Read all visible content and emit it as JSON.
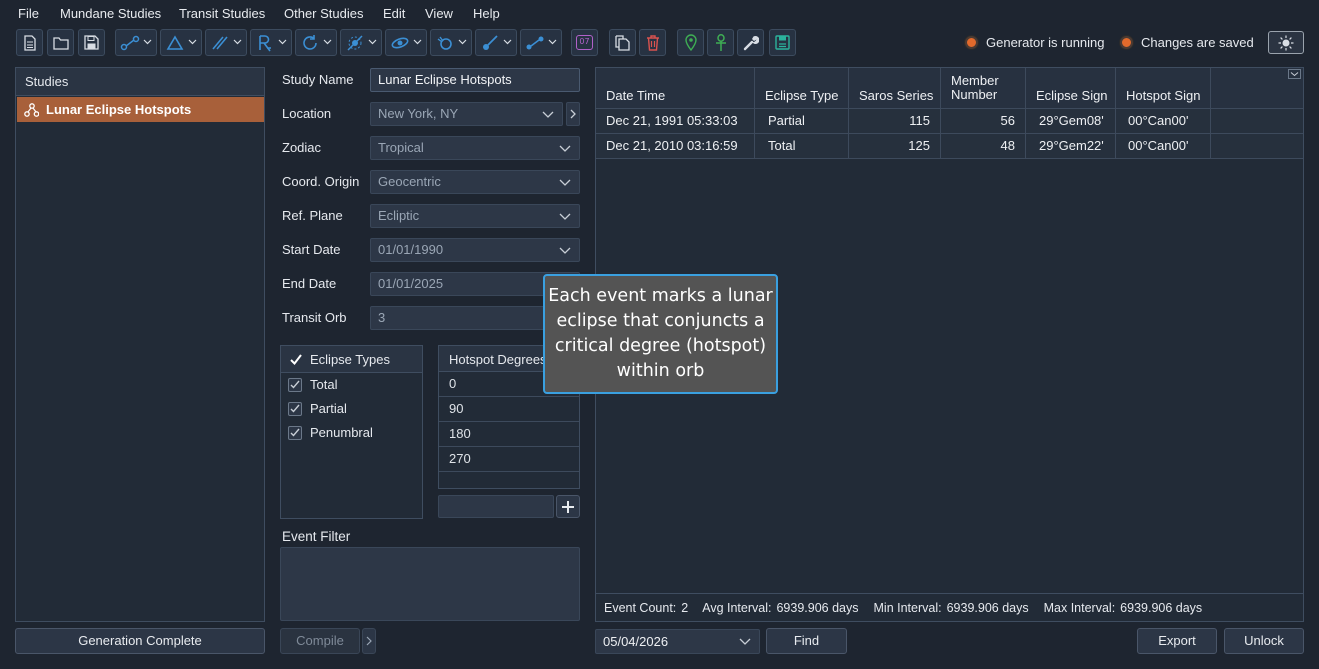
{
  "menu": [
    "File",
    "Mundane Studies",
    "Transit Studies",
    "Other Studies",
    "Edit",
    "View",
    "Help"
  ],
  "toolbar_icons": [
    "new-file-icon",
    "open-folder-icon",
    "save-icon",
    "aspect-line-icon",
    "triangle-icon",
    "parallel-icon",
    "retrograde-icon",
    "cycle-icon",
    "node-icon",
    "eclipse-icon",
    "orbit-icon",
    "comet-icon",
    "connect-icon",
    "calendar-07-icon",
    "copy-icon",
    "trash-icon",
    "location-pin-icon",
    "ankh-icon",
    "wrench-icon",
    "database-icon"
  ],
  "toolbar": {
    "calendar_label": "07"
  },
  "status": {
    "generator": "Generator is running",
    "saved": "Changes are saved"
  },
  "studies": {
    "header": "Studies",
    "items": [
      "Lunar Eclipse Hotspots"
    ],
    "footer_button": "Generation Complete"
  },
  "form": {
    "study_name_label": "Study Name",
    "study_name_value": "Lunar Eclipse Hotspots",
    "location_label": "Location",
    "location_value": "New York, NY",
    "zodiac_label": "Zodiac",
    "zodiac_value": "Tropical",
    "coord_label": "Coord. Origin",
    "coord_value": "Geocentric",
    "ref_label": "Ref. Plane",
    "ref_value": "Ecliptic",
    "start_label": "Start Date",
    "start_value": "01/01/1990",
    "end_label": "End Date",
    "end_value": "01/01/2025",
    "orb_label": "Transit Orb",
    "orb_value": "3"
  },
  "eclipse_types": {
    "header": "Eclipse Types",
    "items": [
      "Total",
      "Partial",
      "Penumbral"
    ]
  },
  "hotspots": {
    "header": "Hotspot Degrees",
    "items": [
      "0",
      "90",
      "180",
      "270"
    ]
  },
  "event_filter": {
    "label": "Event Filter"
  },
  "compile_button": "Compile",
  "table": {
    "columns": [
      "Date Time",
      "Eclipse Type",
      "Saros Series",
      "Member Number",
      "Eclipse Sign",
      "Hotspot Sign"
    ],
    "rows": [
      [
        "Dec 21, 1991 05:33:03",
        "Partial",
        "115",
        "56",
        "29°Gem08'",
        "00°Can00'"
      ],
      [
        "Dec 21, 2010 03:16:59",
        "Total",
        "125",
        "48",
        "29°Gem22'",
        "00°Can00'"
      ]
    ]
  },
  "summary": {
    "count_label": "Event Count:",
    "count": "2",
    "avg_label": "Avg Interval:",
    "avg": "6939.906 days",
    "min_label": "Min Interval:",
    "min": "6939.906 days",
    "max_label": "Max Interval:",
    "max": "6939.906 days"
  },
  "bottom": {
    "date_value": "05/04/2026",
    "find": "Find",
    "export": "Export",
    "unlock": "Unlock"
  },
  "tooltip": "Each event marks a lunar eclipse that conjuncts a critical degree (hotspot) within orb",
  "colors": {
    "accent": "#3b8fd4",
    "selected": "#a8603a",
    "tooltip_border": "#3aa0e0",
    "led": "#e26a2c"
  }
}
